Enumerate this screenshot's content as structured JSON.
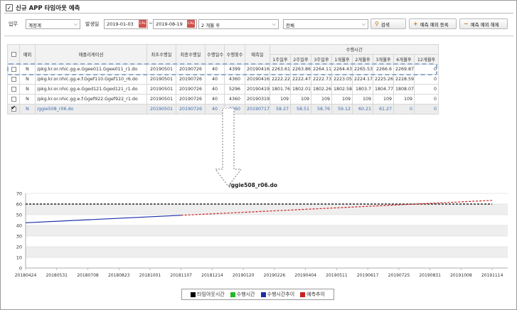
{
  "header": {
    "title": "신규 APP 타임아웃 예측"
  },
  "filter": {
    "work_label": "업무",
    "work_value": "계정계",
    "issue_label": "발생일",
    "date_from": "2019-01-03",
    "date_to": "2019-08-19",
    "date_sep": "~",
    "period_value": "2 개월 후",
    "scope_value": "전체",
    "search_label": "검색",
    "register_label": "예측 예외 등록",
    "release_label": "예측 예외 해제",
    "cal_text": "CAL"
  },
  "table": {
    "headers": {
      "check": "",
      "except": "예외",
      "app": "애플리케이션",
      "first": "최초수행일",
      "last": "최종수행일",
      "days": "수행일수",
      "count": "수행횟수",
      "pred": "예측일",
      "exec_time": "수행시간"
    },
    "sub_headers": [
      "1주일후",
      "2주일후",
      "3주일후",
      "1개월후",
      "2개월후",
      "3개월후",
      "6개월후",
      "12개월후"
    ],
    "rows": [
      {
        "checked": false,
        "ex": "N",
        "app": "/pkg.kr.or.nhic.gg.e.Ggee011.Ggee011_r1.do",
        "first": "20190501",
        "last": "20190726",
        "days": "40",
        "count": "4399",
        "pred": "20190416",
        "vals": [
          "2263.61",
          "2263.86",
          "2264.11",
          "2264.43",
          "2265.53",
          "2266.6",
          "2269.87",
          "0"
        ]
      },
      {
        "checked": false,
        "ex": "N",
        "app": "/pkg.kr.or.nhic.gg.e.f.Ggef110.Ggef110_r6.do",
        "first": "20190501",
        "last": "20190726",
        "days": "40",
        "count": "4360",
        "pred": "20190416",
        "vals": [
          "2222.22",
          "2222.47",
          "2222.73",
          "2223.05",
          "2224.17",
          "2225.26",
          "2228.59",
          "0"
        ]
      },
      {
        "checked": false,
        "ex": "N",
        "app": "/pkg.kr.or.nhic.gg.e.Gged121.Gged121_r1.do",
        "first": "20190501",
        "last": "20190726",
        "days": "40",
        "count": "5296",
        "pred": "20190419",
        "vals": [
          "1801.76",
          "1802.01",
          "1802.26",
          "1802.58",
          "1803.7",
          "1804.77",
          "1808.07",
          "0"
        ]
      },
      {
        "checked": false,
        "ex": "N",
        "app": "/pkg.kr.or.nhic.gg.e.f.Ggef922.Ggef922_r1.do",
        "first": "20190501",
        "last": "20190726",
        "days": "40",
        "count": "4360",
        "pred": "20190319",
        "vals": [
          "109",
          "109",
          "109",
          "109",
          "109",
          "109",
          "109",
          "0"
        ]
      },
      {
        "checked": true,
        "ex": "N",
        "app": "/ggie508_r06.do",
        "first": "20190501",
        "last": "20190726",
        "days": "40",
        "count": "4360",
        "pred": "20190717",
        "vals": [
          "58.27",
          "58.51",
          "58.76",
          "59.12",
          "60.21",
          "61.27",
          "0",
          "0"
        ]
      }
    ]
  },
  "chart_title": "/ggie508_r06.do",
  "chart_data": {
    "type": "line",
    "x": [
      "20180424",
      "20180531",
      "20180708",
      "20180823",
      "20181001",
      "20181107",
      "20181214",
      "20190120",
      "20190226",
      "20190404",
      "20190511",
      "20190617",
      "20190725",
      "20190831",
      "20191008",
      "20191114"
    ],
    "ylim": [
      0,
      70
    ],
    "yticks": [
      0,
      10,
      20,
      30,
      40,
      50,
      60,
      70
    ],
    "grid": true,
    "legend_position": "bottom",
    "series": [
      {
        "name": "타임아웃시간",
        "color": "#000000",
        "style": "dashed",
        "points": [
          [
            "20180424",
            60
          ],
          [
            "20191114",
            60
          ]
        ]
      },
      {
        "name": "수행시간",
        "color": "#22bb22",
        "style": "solid",
        "points": []
      },
      {
        "name": "수행시간추이",
        "color": "#1a2ea8",
        "style": "solid",
        "points": [
          [
            "20180424",
            42.5
          ],
          [
            "20181107",
            49.5
          ]
        ]
      },
      {
        "name": "예측추이",
        "color": "#cc1f1f",
        "style": "dashed",
        "points": [
          [
            "20181107",
            49.5
          ],
          [
            "20191114",
            63.5
          ]
        ]
      }
    ]
  }
}
